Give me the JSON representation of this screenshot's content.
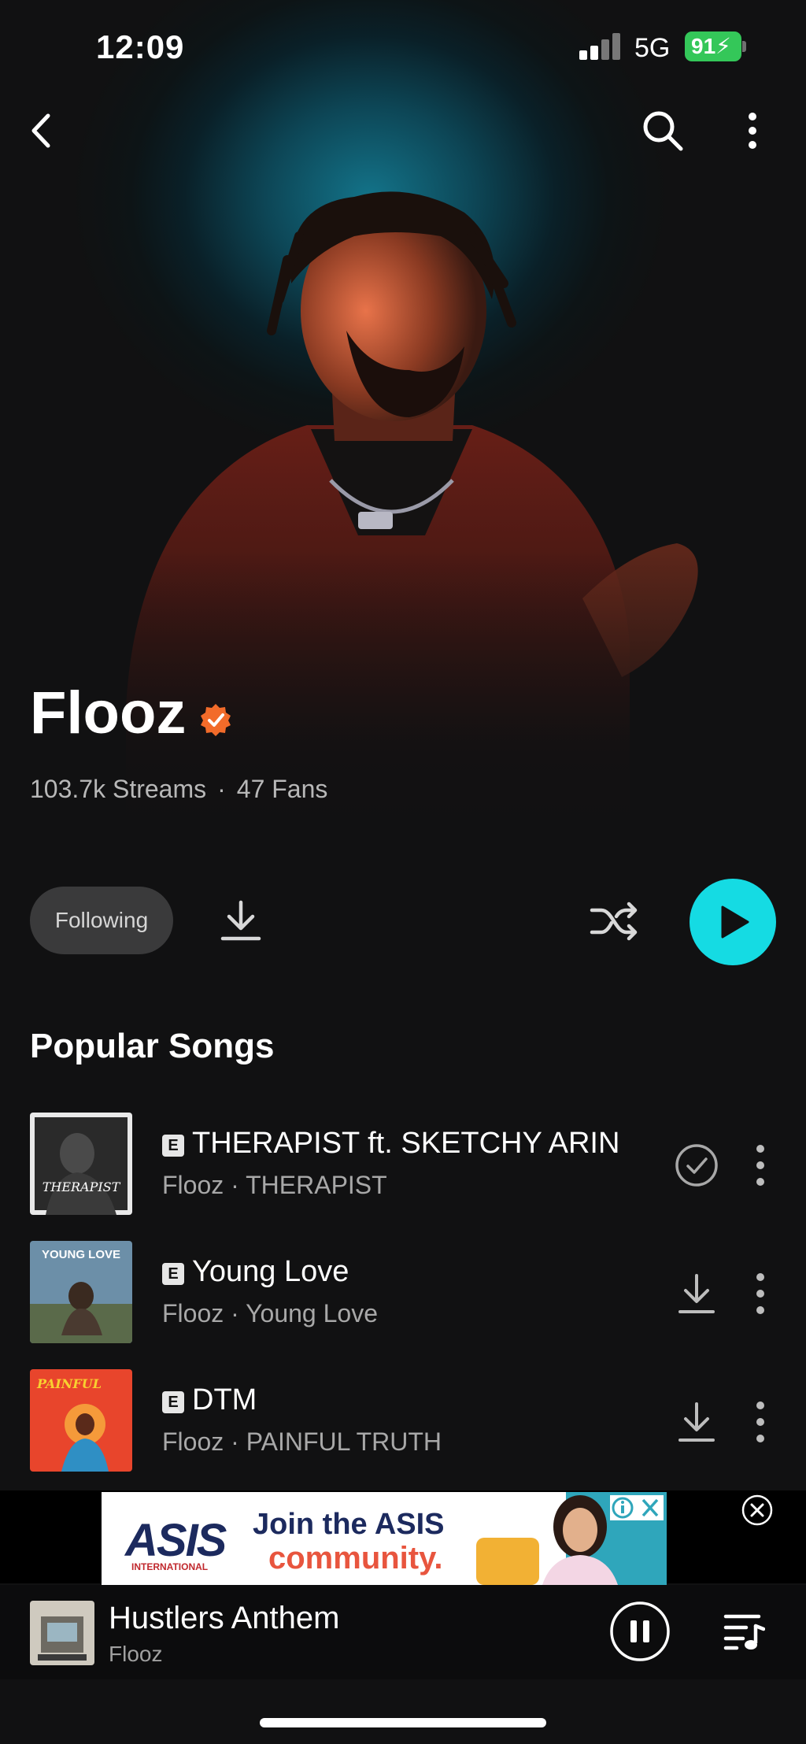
{
  "status_bar": {
    "time": "12:09",
    "network": "5G",
    "battery": "91"
  },
  "nav": {
    "back_icon": "chevron-left-icon",
    "search_icon": "search-icon",
    "more_icon": "more-vertical-icon"
  },
  "artist": {
    "name": "Flooz",
    "verified": true,
    "streams": "103.7k Streams",
    "separator": "·",
    "fans": "47 Fans"
  },
  "actions": {
    "follow_label": "Following"
  },
  "section": {
    "title": "Popular Songs"
  },
  "songs": [
    {
      "explicit": "E",
      "title": "THERAPIST ft. SKETCHY ARIN",
      "subtitle": "Flooz · THERAPIST",
      "status_icon": "downloaded-check-icon"
    },
    {
      "explicit": "E",
      "title": "Young Love",
      "subtitle": "Flooz · Young Love",
      "status_icon": "download-icon"
    },
    {
      "explicit": "E",
      "title": "DTM",
      "subtitle": "Flooz · PAINFUL TRUTH",
      "status_icon": "download-icon"
    }
  ],
  "ad": {
    "logo": "ASIS",
    "logo_sub": "INTERNATIONAL",
    "line1": "Join the ASIS",
    "line2": "community."
  },
  "now_playing": {
    "title": "Hustlers Anthem",
    "artist": "Flooz"
  },
  "colors": {
    "accent": "#15dbe3",
    "verified_badge": "#f26b2a",
    "background": "#111112"
  }
}
